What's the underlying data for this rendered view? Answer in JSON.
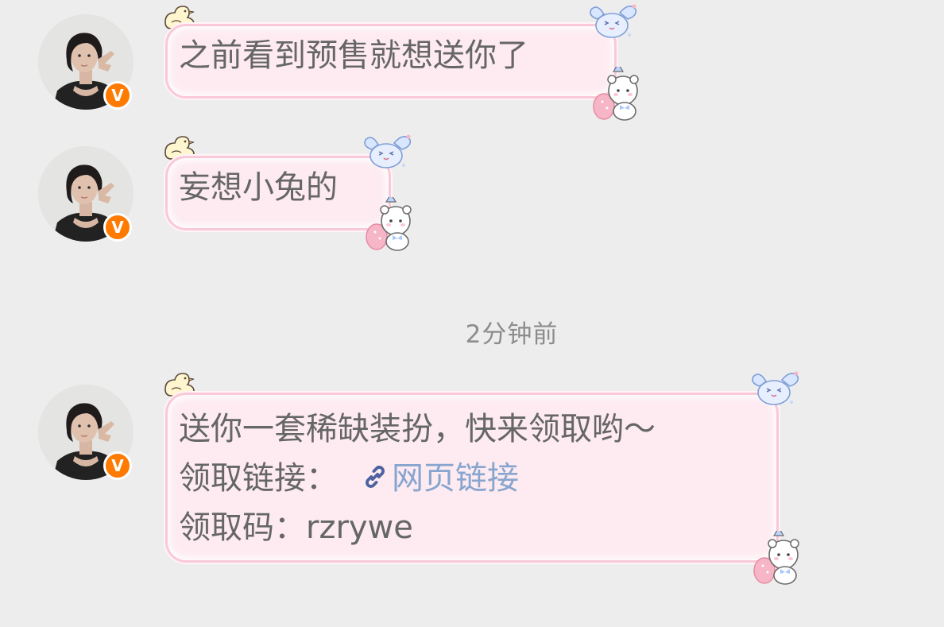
{
  "messages": [
    {
      "text": "之前看到预售就想送你了"
    },
    {
      "text": "妄想小兔的"
    },
    {
      "line1": "送你一套稀缺装扮，快来领取哟～",
      "line2_label": "领取链接：",
      "line2_link": "网页链接",
      "line3": "领取码：rzrywe"
    }
  ],
  "divider": {
    "time": "2分钟前"
  },
  "badge": {
    "letter": "V",
    "color": "#ff7a00"
  },
  "bubble_theme": {
    "fill": "#fdebf1",
    "border": "#f9c9d8",
    "link_color": "#88a5cf"
  },
  "icons": [
    "chick-sticker",
    "bunny-sticker",
    "bear-sticker",
    "link-icon",
    "verified-badge"
  ]
}
